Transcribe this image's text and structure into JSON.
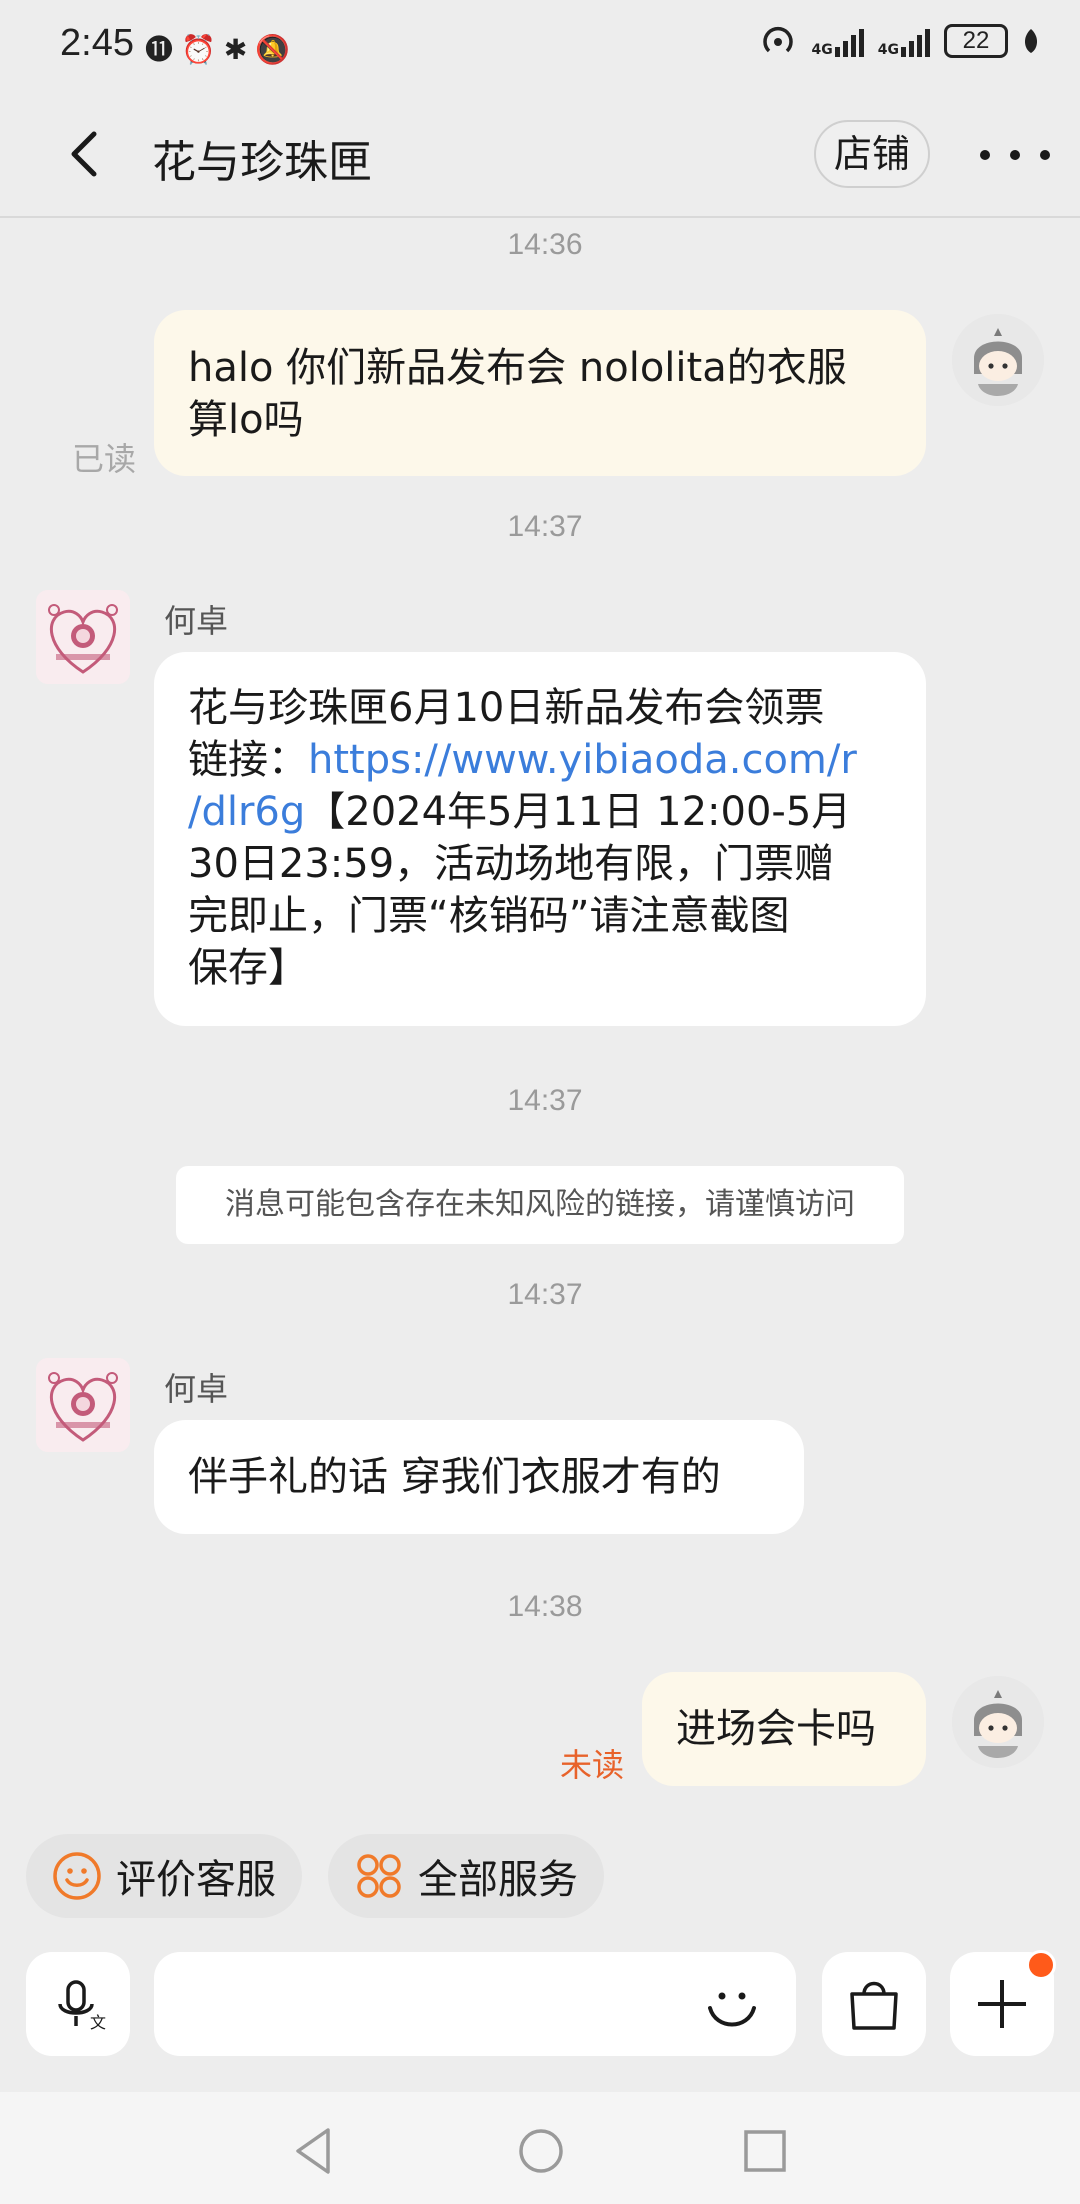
{
  "status_bar": {
    "time": "2:45",
    "battery": "22",
    "network_1": "4G",
    "network_2": "4G"
  },
  "header": {
    "title": "花与珍珠匣",
    "shop_button": "店铺"
  },
  "messages": {
    "t1": "14:36",
    "m1_line1": "halo 你们新品发布会 nololita的衣服",
    "m1_line2": "算lo吗",
    "m1_status": "已读",
    "t2": "14:37",
    "m2_sender": "何卓",
    "m2_line1": "花与珍珠匣6月10日新品发布会领票",
    "m2_line2_prefix": "链接：",
    "m2_link_part1": "https://www.yibiaoda.com/r",
    "m2_link_part2": "/dlr6g",
    "m2_line3_suffix": "【2024年5月11日 12:00-5月",
    "m2_line4": "30日23:59，活动场地有限，门票赠",
    "m2_line5": "完即止，门票“核销码”请注意截图",
    "m2_line6": "保存】",
    "t3": "14:37",
    "system_notice": "消息可能包含存在未知风险的链接，请谨慎访问",
    "t4": "14:37",
    "m3_sender": "何卓",
    "m3_text": "伴手礼的话 穿我们衣服才有的",
    "t5": "14:38",
    "m4_text": "进场会卡吗",
    "m4_status": "未读"
  },
  "quick_actions": {
    "rate_service": "评价客服",
    "all_services": "全部服务"
  },
  "input": {
    "placeholder": ""
  },
  "colors": {
    "accent_orange": "#f07a2a",
    "link_blue": "#3b7ddb",
    "unread_orange": "#e8622a",
    "my_bubble": "#fdf8ea"
  }
}
